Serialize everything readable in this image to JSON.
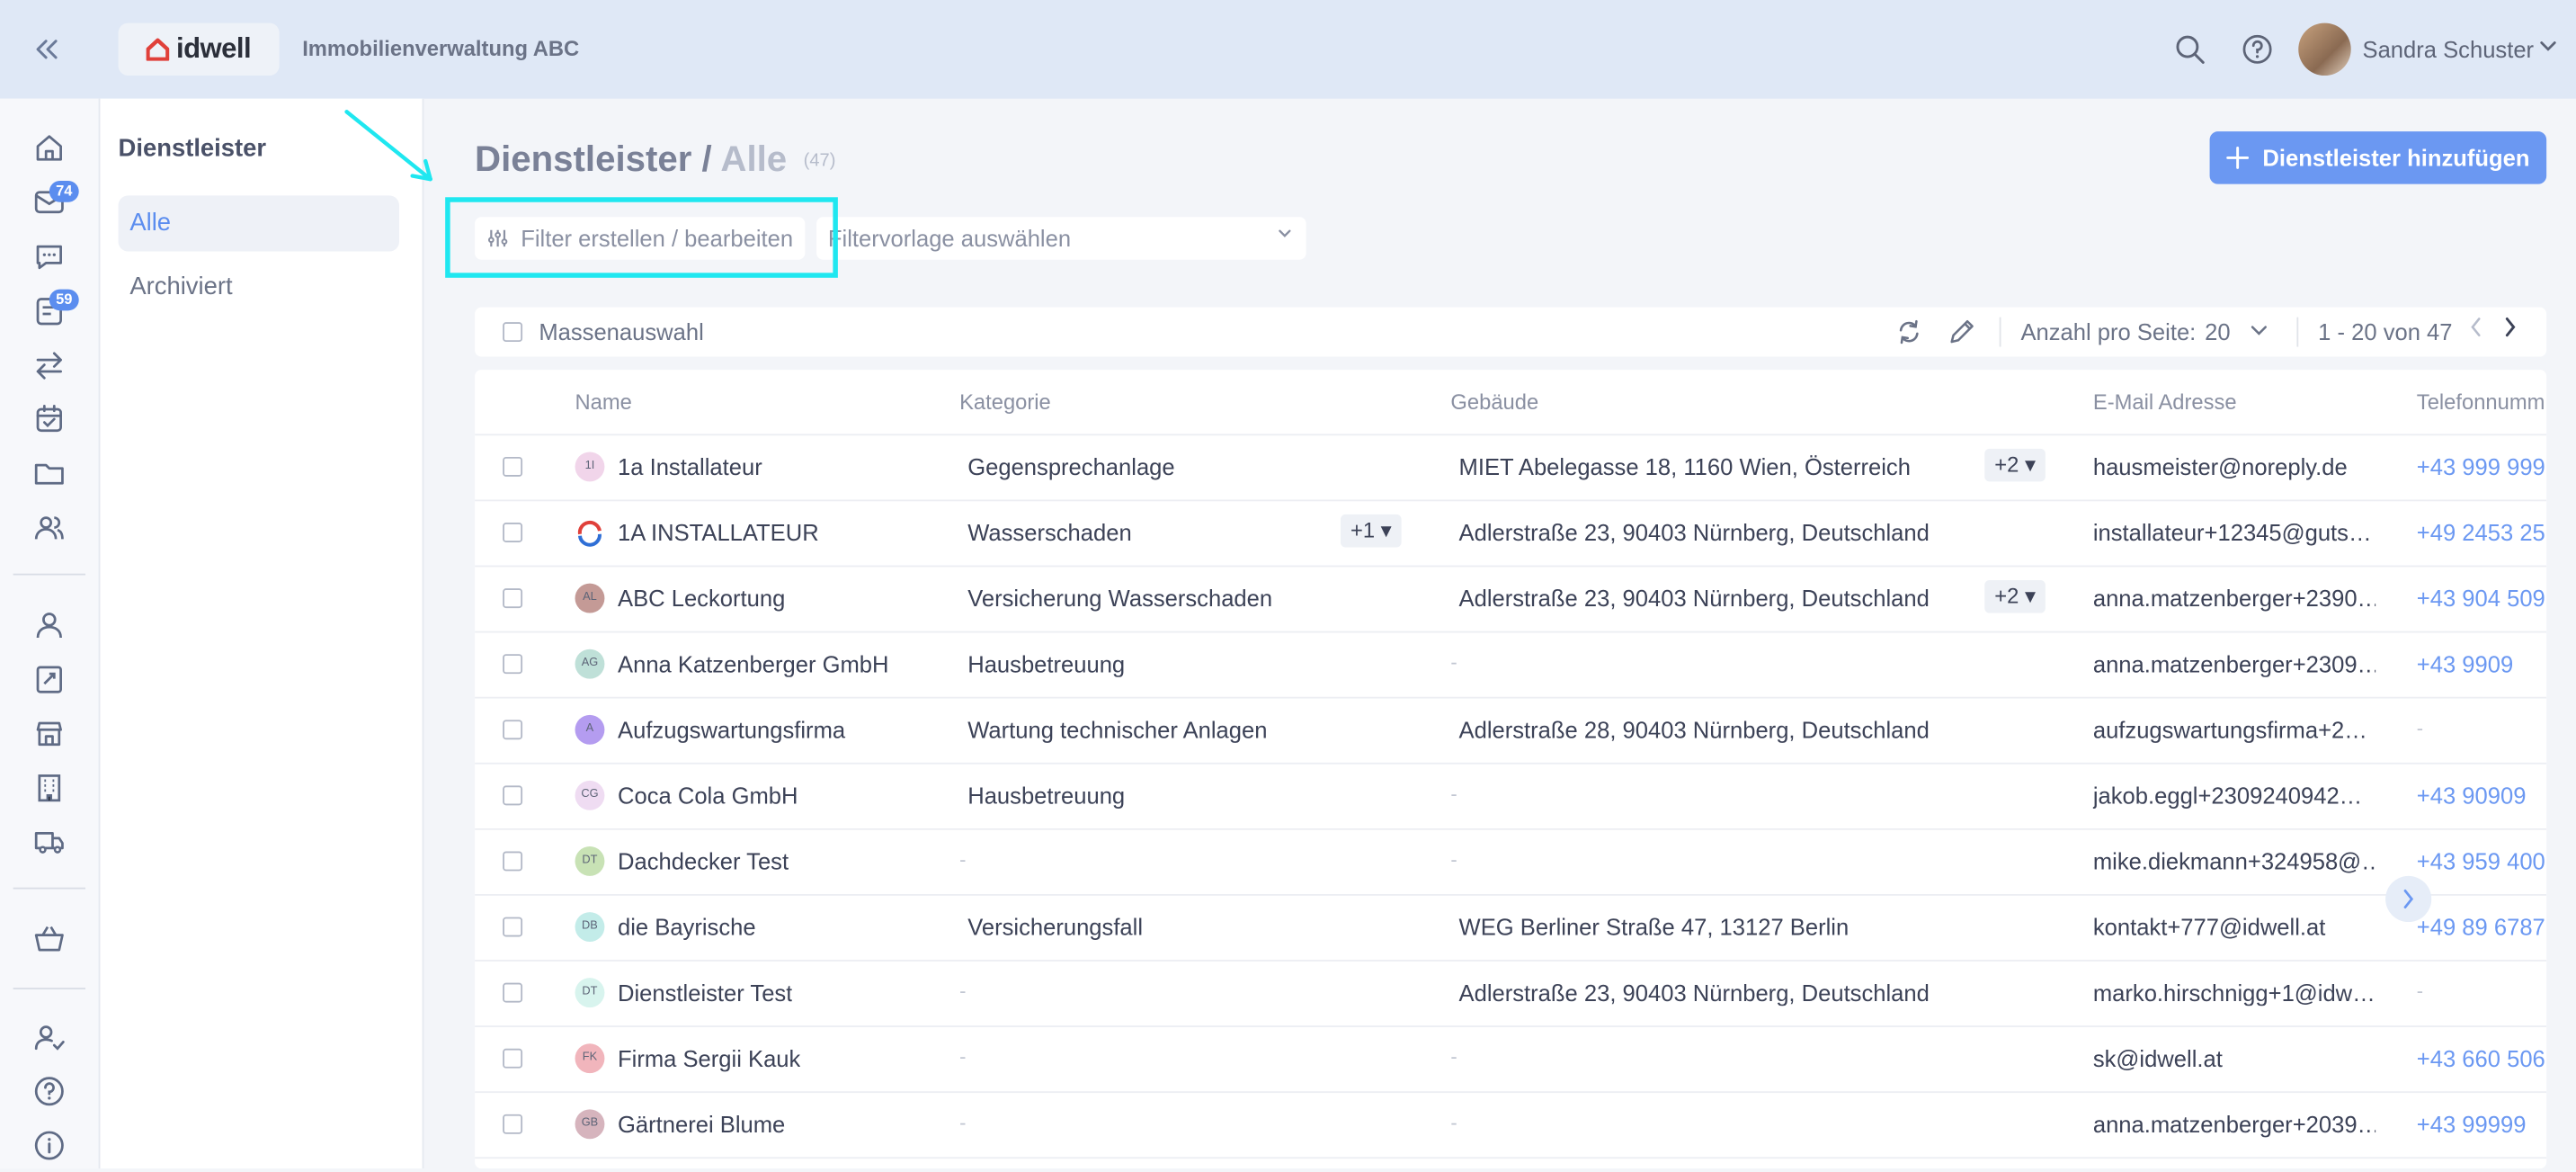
{
  "topbar": {
    "brand": "idwell",
    "company": "Immobilienverwaltung ABC",
    "user_name": "Sandra Schuster"
  },
  "rail": {
    "badges": {
      "inbox": "74",
      "tasks": "59"
    }
  },
  "subnav": {
    "title": "Dienstleister",
    "items": [
      {
        "label": "Alle"
      },
      {
        "label": "Archiviert"
      }
    ]
  },
  "page": {
    "title": "Dienstleister",
    "separator": "/",
    "subtitle": "Alle",
    "count": "(47)",
    "add_button": "Dienstleister hinzufügen"
  },
  "filters": {
    "filter_button": "Filter erstellen / bearbeiten",
    "preset_placeholder": "Filtervorlage auswählen"
  },
  "toolbar": {
    "mass_select": "Massenauswahl",
    "per_page_label": "Anzahl pro Seite:",
    "per_page_value": "20",
    "range": "1 - 20 von 47"
  },
  "table": {
    "columns": [
      "Name",
      "Kategorie",
      "Gebäude",
      "E-Mail Adresse",
      "Telefonnumm"
    ],
    "rows": [
      {
        "initials": "1I",
        "avatar_color": "#f1d5ea",
        "name": "1a Installateur",
        "category": "Gegensprechanlage",
        "category_more": "",
        "building": "MIET Abelegasse 18, 1160 Wien, Österreich",
        "building_more": "+2",
        "email": "hausmeister@noreply.de",
        "phone": "+43 999 999"
      },
      {
        "initials": "",
        "avatar_color": "#ffffff",
        "logo": true,
        "name": "1A INSTALLATEUR",
        "category": "Wasserschaden",
        "category_more": "+1",
        "building": "Adlerstraße 23, 90403 Nürnberg, Deutschland",
        "building_more": "",
        "email": "installateur+12345@guts…",
        "phone": "+49 2453 25"
      },
      {
        "initials": "AL",
        "avatar_color": "#c49a96",
        "name": "ABC Leckortung",
        "category": "Versicherung Wasserschaden",
        "category_more": "",
        "building": "Adlerstraße 23, 90403 Nürnberg, Deutschland",
        "building_more": "+2",
        "email": "anna.matzenberger+2390…",
        "phone": "+43 904 509"
      },
      {
        "initials": "AG",
        "avatar_color": "#bfe0d8",
        "name": "Anna Katzenberger GmbH",
        "category": "Hausbetreuung",
        "category_more": "",
        "building": "-",
        "building_more": "",
        "email": "anna.matzenberger+2309…",
        "phone": "+43 9909"
      },
      {
        "initials": "A",
        "avatar_color": "#b49cf0",
        "name": "Aufzugswartungsfirma",
        "category": "Wartung technischer Anlagen",
        "category_more": "",
        "building": "Adlerstraße 28, 90403 Nürnberg, Deutschland",
        "building_more": "",
        "email": "aufzugswartungsfirma+2…",
        "phone": "-"
      },
      {
        "initials": "CG",
        "avatar_color": "#efdcf2",
        "name": "Coca Cola GmbH",
        "category": "Hausbetreuung",
        "category_more": "",
        "building": "-",
        "building_more": "",
        "email": "jakob.eggl+2309240942…",
        "phone": "+43 90909"
      },
      {
        "initials": "DT",
        "avatar_color": "#c8e2b5",
        "name": "Dachdecker Test",
        "category": "-",
        "category_more": "",
        "building": "-",
        "building_more": "",
        "email": "mike.diekmann+324958@…",
        "phone": "+43 959 400"
      },
      {
        "initials": "DB",
        "avatar_color": "#c3ece9",
        "name": "die Bayrische",
        "category": "Versicherungsfall",
        "category_more": "",
        "building": "WEG Berliner Straße 47, 13127 Berlin",
        "building_more": "",
        "email": "kontakt+777@idwell.at",
        "phone": "+49 89 6787"
      },
      {
        "initials": "DT",
        "avatar_color": "#d8f4ee",
        "name": "Dienstleister Test",
        "category": "-",
        "category_more": "",
        "building": "Adlerstraße 23, 90403 Nürnberg, Deutschland",
        "building_more": "",
        "email": "marko.hirschnigg+1@idw…",
        "phone": "-"
      },
      {
        "initials": "FK",
        "avatar_color": "#f1b5bc",
        "name": "Firma Sergii Kauk",
        "category": "-",
        "category_more": "",
        "building": "-",
        "building_more": "",
        "email": "sk@idwell.at",
        "phone": "+43 660 506"
      },
      {
        "initials": "GB",
        "avatar_color": "#d6b4bd",
        "name": "Gärtnerei Blume",
        "category": "-",
        "category_more": "",
        "building": "-",
        "building_more": "",
        "email": "anna.matzenberger+2039…",
        "phone": "+43 99999"
      }
    ]
  },
  "colors": {
    "accent": "#6b98f2",
    "highlight": "#1fe7f0",
    "topbar": "#dfe8f6"
  }
}
